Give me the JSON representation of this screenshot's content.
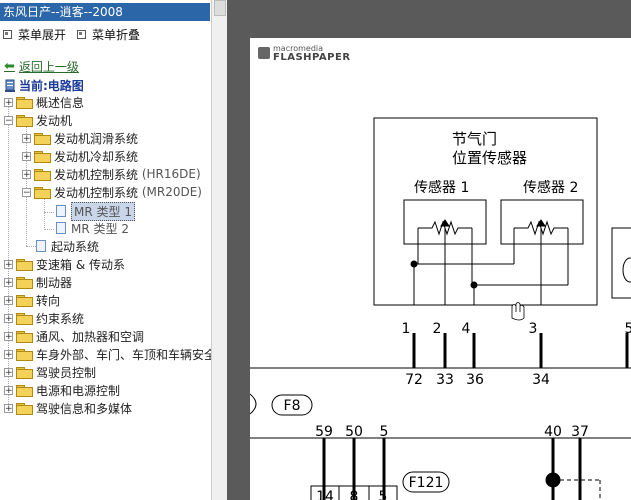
{
  "window": {
    "title": "东风日产--逍客--2008"
  },
  "menu": {
    "expand_label": "菜单展开",
    "collapse_label": "菜单折叠"
  },
  "nav": {
    "back_label": "返回上一级",
    "current_label": "当前:电路图"
  },
  "tree": {
    "gaishu": "概述信息",
    "fadongji": "发动机",
    "runhua": "发动机润滑系统",
    "lengque": "发动机冷却系统",
    "kongzhi_hr": "发动机控制系统",
    "kongzhi_hr_code": "(HR16DE)",
    "kongzhi_mr": "发动机控制系统",
    "kongzhi_mr_code": "(MR20DE)",
    "mr1": "MR 类型 1",
    "mr2": "MR 类型 2",
    "qidong": "起动系统",
    "biansu": "变速箱 & 传动系",
    "zhidong": "制动器",
    "zhuanxiang": "转向",
    "yueshu": "约束系统",
    "tongfeng": "通风、加热器和空调",
    "cheshen": "车身外部、车门、车顶和车辆安全",
    "jiashiyuan": "驾驶员控制",
    "dianyuan": "电源和电源控制",
    "xinxi": "驾驶信息和多媒体"
  },
  "viewer": {
    "brand_small": "macromedia",
    "brand_big": "FLASHPAPER"
  },
  "diagram": {
    "title1": "节气门",
    "title2": "位置传感器",
    "sensor1": "传感器 1",
    "sensor2": "传感器 2",
    "pin1": "1",
    "pin2": "2",
    "pin4": "4",
    "pin3": "3",
    "pin5": "5",
    "wire72": "72",
    "wire33": "33",
    "wire36": "36",
    "wire34": "34",
    "f8": "F8",
    "n59": "59",
    "n50": "50",
    "n5": "5",
    "n40": "40",
    "n37": "37",
    "f121": "F121",
    "c14": "14",
    "c8": "8",
    "c5": "5"
  }
}
